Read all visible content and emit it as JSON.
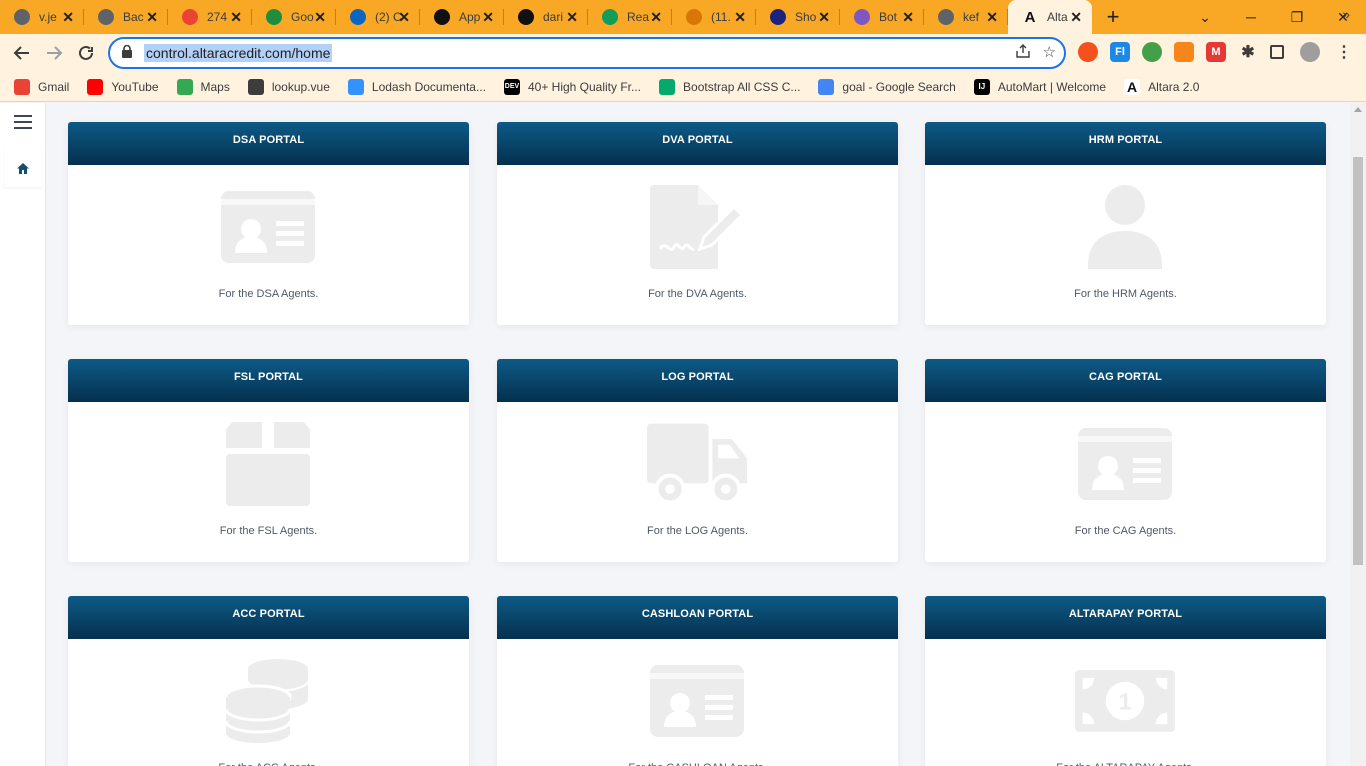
{
  "browser": {
    "tabs": [
      {
        "title": "v.je",
        "icon": "globe-icon",
        "color": "#5f6368"
      },
      {
        "title": "Bac",
        "icon": "globe-icon",
        "color": "#5f6368"
      },
      {
        "title": "274",
        "icon": "gmail-icon",
        "color": "#ea4335"
      },
      {
        "title": "Goo",
        "icon": "google-ads-icon",
        "color": "#1e8e3e"
      },
      {
        "title": "(2) C",
        "icon": "linkedin-icon",
        "color": "#0a66c2"
      },
      {
        "title": "App",
        "icon": "app-icon",
        "color": "#111111"
      },
      {
        "title": "dari",
        "icon": "github-icon",
        "color": "#111111"
      },
      {
        "title": "Rea",
        "icon": "tree-icon",
        "color": "#0f9d58"
      },
      {
        "title": "(11.",
        "icon": "chart-icon",
        "color": "#d97706"
      },
      {
        "title": "Sho",
        "icon": "w-icon",
        "color": "#1a237e"
      },
      {
        "title": "Bot",
        "icon": "bot-icon",
        "color": "#7e57c2"
      },
      {
        "title": "kef",
        "icon": "globe-icon",
        "color": "#5f6368"
      },
      {
        "title": "Alta",
        "icon": "altara-icon",
        "color": "#ffffff",
        "active": true
      }
    ],
    "url": "control.altaracredit.com/home",
    "bookmarks": [
      {
        "label": "Gmail",
        "icon": "gmail-icon",
        "color": "#ea4335"
      },
      {
        "label": "YouTube",
        "icon": "youtube-icon",
        "color": "#ff0000"
      },
      {
        "label": "Maps",
        "icon": "maps-icon",
        "color": "#34a853"
      },
      {
        "label": "lookup.vue",
        "icon": "globe-icon",
        "color": "#3c3c3c"
      },
      {
        "label": "Lodash Documenta...",
        "icon": "lodash-icon",
        "color": "#3492ff"
      },
      {
        "label": "40+ High Quality Fr...",
        "icon": "dev-icon",
        "color": "#000000"
      },
      {
        "label": "Bootstrap All CSS C...",
        "icon": "w3-icon",
        "color": "#04aa6d"
      },
      {
        "label": "goal - Google Search",
        "icon": "google-icon",
        "color": "#4285f4"
      },
      {
        "label": "AutoMart | Welcome",
        "icon": "intellij-icon",
        "color": "#000000"
      },
      {
        "label": "Altara 2.0",
        "icon": "altara-icon",
        "color": "#ffffff"
      }
    ]
  },
  "portals": [
    {
      "title": "DSA PORTAL",
      "desc": "For the DSA Agents.",
      "icon": "id-card-icon"
    },
    {
      "title": "DVA PORTAL",
      "desc": "For the DVA Agents.",
      "icon": "file-signature-icon"
    },
    {
      "title": "HRM PORTAL",
      "desc": "For the HRM Agents.",
      "icon": "user-icon"
    },
    {
      "title": "FSL PORTAL",
      "desc": "For the FSL Agents.",
      "icon": "box-icon"
    },
    {
      "title": "LOG PORTAL",
      "desc": "For the LOG Agents.",
      "icon": "truck-icon"
    },
    {
      "title": "CAG PORTAL",
      "desc": "For the CAG Agents.",
      "icon": "id-card-icon"
    },
    {
      "title": "ACC PORTAL",
      "desc": "For the ACC Agents.",
      "icon": "coins-icon"
    },
    {
      "title": "CASHLOAN PORTAL",
      "desc": "For the CASHLOAN Agents.",
      "icon": "id-card-icon"
    },
    {
      "title": "ALTARAPAY PORTAL",
      "desc": "For the ALTARAPAY Agents.",
      "icon": "money-bill-icon"
    }
  ],
  "colors": {
    "tab_strip": "#f9a825",
    "toolbar": "#fff3e0",
    "card_header": "#0d5a87",
    "icon_gray": "#ececec"
  }
}
